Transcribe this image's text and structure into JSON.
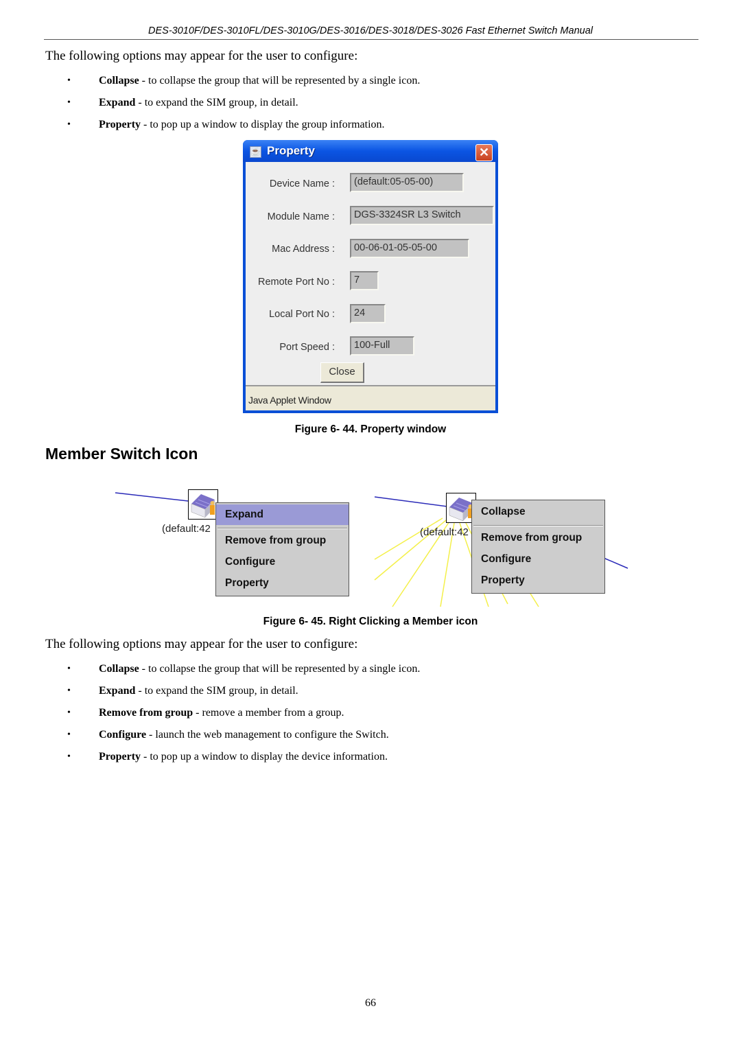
{
  "header": {
    "manual_title": "DES-3010F/DES-3010FL/DES-3010G/DES-3016/DES-3018/DES-3026 Fast Ethernet Switch Manual"
  },
  "section1": {
    "intro": "The following options may appear for the user to configure:",
    "bullets": [
      {
        "term": "Collapse",
        "desc": " - to collapse the group that will be represented by a single icon."
      },
      {
        "term": "Expand",
        "desc": " - to expand the SIM group, in detail."
      },
      {
        "term": "Property",
        "desc": " - to pop up a window to display the group information."
      }
    ]
  },
  "property_window": {
    "title": "Property",
    "title_icon": "java-cup-icon",
    "close_glyph": "✕",
    "fields": [
      {
        "label": "Device Name :",
        "value": "(default:05-05-00)"
      },
      {
        "label": "Module Name :",
        "value": "DGS-3324SR L3 Switch"
      },
      {
        "label": "Mac Address :",
        "value": "00-06-01-05-05-00"
      },
      {
        "label": "Remote Port No :",
        "value": "7"
      },
      {
        "label": "Local Port No :",
        "value": "24"
      },
      {
        "label": "Port Speed :",
        "value": "100-Full"
      }
    ],
    "close_button": "Close",
    "status_bar": "Java Applet Window"
  },
  "figure44_caption": "Figure 6- 44. Property window",
  "section_title": "Member Switch Icon",
  "figure45": {
    "left": {
      "node_label": "(default:42",
      "menu": [
        {
          "label": "Expand",
          "selected": true
        },
        {
          "label": "Remove from group",
          "selected": false
        },
        {
          "label": "Configure",
          "selected": false
        },
        {
          "label": "Property",
          "selected": false
        }
      ]
    },
    "right": {
      "node_label": "(default:42",
      "menu": [
        {
          "label": "Collapse",
          "selected": false
        },
        {
          "label": "Remove from group",
          "selected": false
        },
        {
          "label": "Configure",
          "selected": false
        },
        {
          "label": "Property",
          "selected": false
        }
      ]
    },
    "colors": {
      "link_line": "#2a2ab8",
      "child_links": "#f4f04a",
      "menu_bg": "#cdcdcd",
      "menu_selected": "#9a9ad6"
    }
  },
  "figure45_caption": "Figure 6- 45. Right Clicking a Member icon",
  "section2": {
    "intro": "The following options may appear for the user to configure:",
    "bullets": [
      {
        "term": "Collapse",
        "desc": " - to collapse the group that will be represented by a single icon."
      },
      {
        "term": "Expand",
        "desc": " - to expand the SIM group, in detail."
      },
      {
        "term": "Remove from group",
        "desc": " - remove a member from a group."
      },
      {
        "term": "Configure",
        "desc": " - launch the web management to configure the Switch."
      },
      {
        "term": "Property",
        "desc": " - to pop up a window to display the device information."
      }
    ]
  },
  "page_number": "66"
}
